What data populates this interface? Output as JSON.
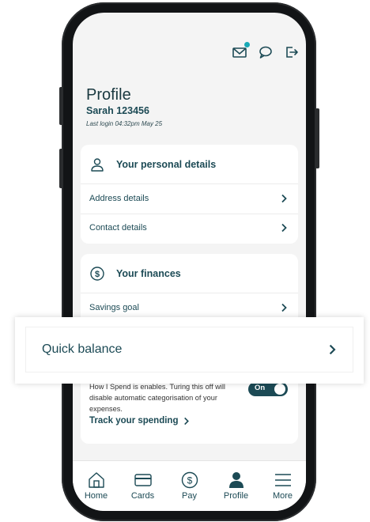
{
  "header": {
    "title": "Profile",
    "user": "Sarah 123456",
    "last_login": "Last login 04:32pm May 25",
    "icons": [
      "mail-icon",
      "chat-icon",
      "logout-icon"
    ]
  },
  "personal": {
    "heading": "Your personal details",
    "items": [
      {
        "label": "Address details"
      },
      {
        "label": "Contact details"
      }
    ]
  },
  "finances": {
    "heading": "Your finances",
    "savings_label": "Savings goal"
  },
  "spending": {
    "description": "How I Spend is enables. Turing this off will disable automatic categorisation of your expenses.",
    "toggle_label": "On",
    "toggle_state": "on",
    "link_label": "Track your spending"
  },
  "overlay": {
    "label": "Quick balance"
  },
  "tabbar": {
    "items": [
      {
        "label": "Home",
        "icon": "home-icon"
      },
      {
        "label": "Cards",
        "icon": "card-icon"
      },
      {
        "label": "Pay",
        "icon": "dollar-icon"
      },
      {
        "label": "Profile",
        "icon": "person-icon"
      },
      {
        "label": "More",
        "icon": "menu-icon"
      }
    ]
  },
  "colors": {
    "accent": "#1c4a55",
    "notification": "#19a9b6",
    "background": "#f4f4f4"
  }
}
